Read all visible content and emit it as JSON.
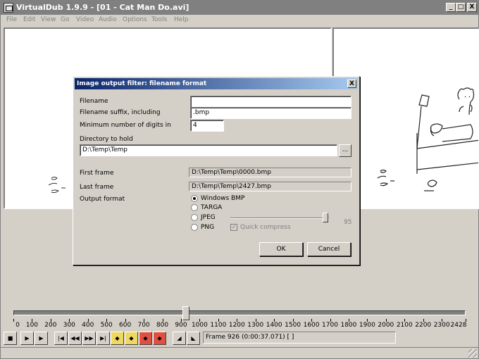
{
  "window": {
    "title": "VirtualDub 1.9.9 - [01 - Cat Man Do.avi]",
    "controls": [
      "_",
      "□",
      "X"
    ]
  },
  "menu": [
    "File",
    "Edit",
    "View",
    "Go",
    "Video",
    "Audio",
    "Options",
    "Tools",
    "Help"
  ],
  "dialog": {
    "title": "Image output filter: filename format",
    "close_label": "X",
    "filename_label": "Filename",
    "filename_value": "",
    "suffix_label": "Filename suffix, including",
    "suffix_value": ".bmp",
    "digits_label": "Minimum number of digits in",
    "digits_value": "4",
    "directory_label": "Directory to hold",
    "directory_value": "D:\\Temp\\Temp",
    "browse_label": "...",
    "first_frame_label": "First frame",
    "first_frame_value": "D:\\Temp\\Temp\\0000.bmp",
    "last_frame_label": "Last frame",
    "last_frame_value": "D:\\Temp\\Temp\\2427.bmp",
    "output_format_label": "Output format",
    "formats": [
      "Windows BMP",
      "TARGA",
      "JPEG",
      "PNG"
    ],
    "selected_format": "Windows BMP",
    "quality_value": "95",
    "quick_compress_label": "Quick compress",
    "quick_compress_checked": true,
    "ok_label": "OK",
    "cancel_label": "Cancel"
  },
  "timeline": {
    "ticks": [
      "0",
      "100",
      "200",
      "300",
      "400",
      "500",
      "600",
      "700",
      "800",
      "900",
      "1000",
      "1100",
      "1200",
      "1300",
      "1400",
      "1500",
      "1600",
      "1700",
      "1800",
      "1900",
      "2000",
      "2100",
      "2200",
      "2300",
      "2428"
    ],
    "current_frame": 926,
    "total_frames": 2428
  },
  "frame_status": "Frame 926 (0:00:37.071) [ ]"
}
